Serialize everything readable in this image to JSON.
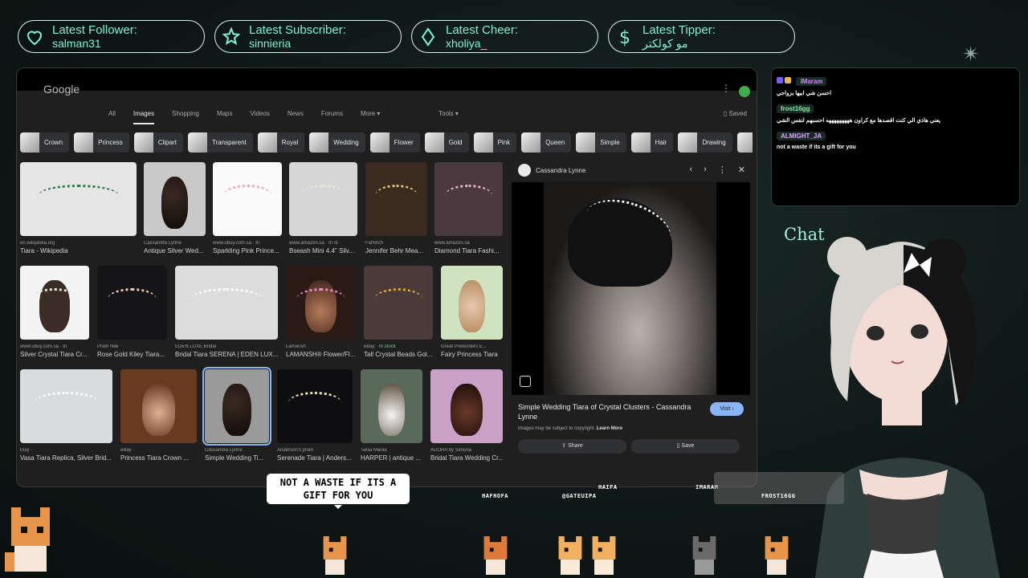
{
  "alerts": [
    {
      "label": "Latest Follower:",
      "value": "salman31",
      "icon": "heart-icon"
    },
    {
      "label": "Latest Subscriber:",
      "value": "sinnieria",
      "icon": "star-icon"
    },
    {
      "label": "Latest Cheer:",
      "value": "xholiya_",
      "icon": "diamond-icon"
    },
    {
      "label": "Latest Tipper:",
      "value": "مو كولكتر",
      "icon": "dollar-icon"
    }
  ],
  "browser": {
    "logo": "Google",
    "tabs": [
      "All",
      "Images",
      "Shopping",
      "Maps",
      "Videos",
      "News",
      "Forums",
      "More ▾"
    ],
    "active_tab": "Images",
    "tools": "Tools ▾",
    "saved": "Saved",
    "chips": [
      "Crown",
      "Princess",
      "Clipart",
      "Transparent",
      "Royal",
      "Wedding",
      "Flower",
      "Gold",
      "Pink",
      "Queen",
      "Simple",
      "Hair",
      "Drawing",
      "Si"
    ],
    "results": [
      [
        {
          "src": "en.wikipedia.org",
          "title": "Tiara - Wikipedia",
          "stock": ""
        },
        {
          "src": "Cassandra Lynne",
          "title": "Antique Silver Wed...",
          "stock": ""
        },
        {
          "src": "www.ubuy.com.sa · In",
          "title": "Sparkling Pink Prince...",
          "stock": ""
        },
        {
          "src": "www.amazon.sa · In st",
          "title": "Bseash Mini 4.4\" Silv...",
          "stock": ""
        },
        {
          "src": "Farfetch",
          "title": "Jennifer Behr Mea...",
          "stock": ""
        },
        {
          "src": "www.amazon.sa",
          "title": "Diamond Tiara Fashi...",
          "stock": ""
        }
      ],
      [
        {
          "src": "www.ubuy.com.sa · In",
          "title": "Silver Crystal Tiara Cr...",
          "stock": ""
        },
        {
          "src": "Pram Nile",
          "title": "Rose Gold Kiley Tiara...",
          "stock": ""
        },
        {
          "src": "EDEN LUXE Bridal",
          "title": "Bridal Tiara SERENA | EDEN LUX...",
          "stock": ""
        },
        {
          "src": "Lamansh",
          "title": "LAMANSH® Flower/Fl...",
          "stock": ""
        },
        {
          "src": "eBay · ",
          "title": "Tall Crystal Beads Gol...",
          "stock": "In stock"
        },
        {
          "src": "Great Pretenders E...",
          "title": "Fairy Princess Tiara",
          "stock": ""
        }
      ],
      [
        {
          "src": "Etsy · ",
          "title": "Vasa Tiara Replica, Silver Brid...",
          "stock": "In stock"
        },
        {
          "src": "eBay · ",
          "title": "Princess Tiara Crown ...",
          "stock": "In stock"
        },
        {
          "src": "Cassandra Lynne",
          "title": "Simple Wedding Ti...",
          "stock": ""
        },
        {
          "src": "Anderson's prom",
          "title": "Serenade Tiara | Anders...",
          "stock": ""
        },
        {
          "src": "Tania Maras",
          "title": "HARPER | antique ...",
          "stock": ""
        },
        {
          "src": "ADORA by Simona",
          "title": "Bridal Tiara Wedding Cr...",
          "stock": ""
        }
      ]
    ],
    "preview": {
      "source": "Cassandra Lynne",
      "title": "Simple Wedding Tiara of Crystal Clusters - Cassandra Lynne",
      "visit": "Visit ›",
      "copyright": "Images may be subject to copyright.",
      "learn_more": "Learn More",
      "share": "Share",
      "save": "Save"
    }
  },
  "chat": {
    "label": "Chat",
    "messages": [
      {
        "user": "iMaram",
        "color": "#d18cff",
        "text": "احسن شي ابيها بزواجي"
      },
      {
        "user": "frost16gg",
        "color": "#7ef0a0",
        "text": "يعني هاذي الي كنت اقصدها مع كراون هههههههههه احسبهم لنفس الشي"
      },
      {
        "user": "ALMIGHT_JA",
        "color": "#d9a6ff",
        "text": "not a waste if its a gift for you"
      }
    ]
  },
  "overlay": {
    "bubble": "NOT A WASTE IF ITS A GIFT FOR YOU",
    "pets": [
      "HAFHOFA",
      "@GATEUIPA",
      "HAIFA",
      "IMARAM",
      "FROST16GG"
    ]
  }
}
